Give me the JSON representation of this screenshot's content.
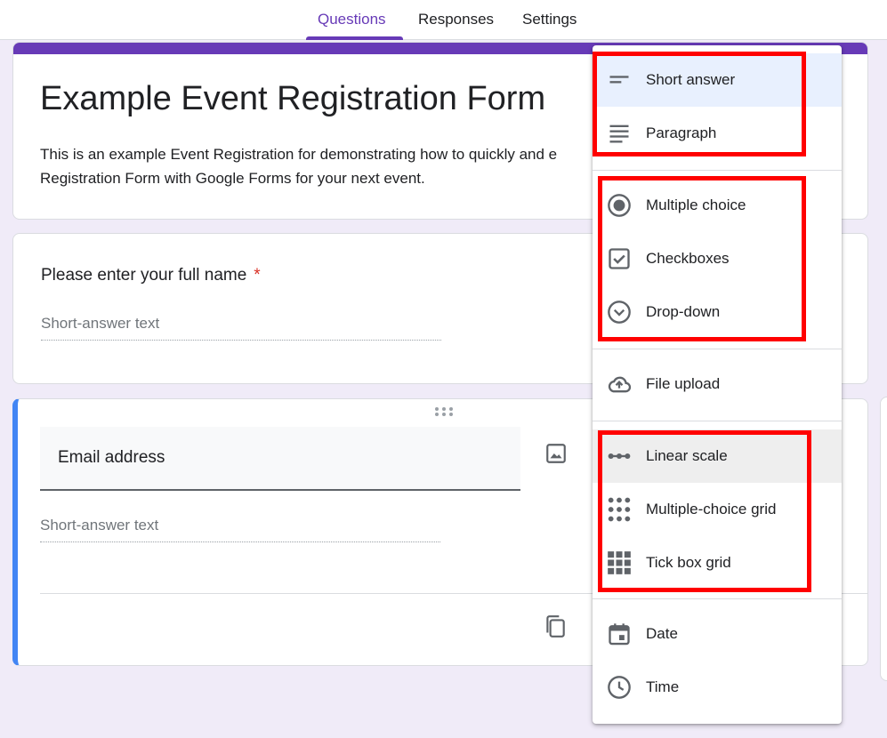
{
  "tabs": [
    {
      "label": "Questions",
      "active": true
    },
    {
      "label": "Responses",
      "active": false
    },
    {
      "label": "Settings",
      "active": false
    }
  ],
  "form": {
    "title": "Example Event Registration Form",
    "description": "This is an example Event Registration for demonstrating how to quickly and e Registration Form with Google Forms for your next event."
  },
  "questions": [
    {
      "title": "Please enter your full name",
      "required_mark": "*",
      "placeholder": "Short-answer text"
    },
    {
      "title": "Email address",
      "placeholder": "Short-answer text"
    }
  ],
  "type_menu": {
    "items": [
      {
        "label": "Short answer",
        "icon": "short-answer-icon",
        "state": "selected"
      },
      {
        "label": "Paragraph",
        "icon": "paragraph-icon"
      },
      {
        "label": "Multiple choice",
        "icon": "radio-icon"
      },
      {
        "label": "Checkboxes",
        "icon": "checkbox-icon"
      },
      {
        "label": "Drop-down",
        "icon": "dropdown-icon"
      },
      {
        "label": "File upload",
        "icon": "cloud-upload-icon"
      },
      {
        "label": "Linear scale",
        "icon": "linear-scale-icon",
        "state": "hover"
      },
      {
        "label": "Multiple-choice grid",
        "icon": "dot-grid-icon"
      },
      {
        "label": "Tick box grid",
        "icon": "square-grid-icon"
      },
      {
        "label": "Date",
        "icon": "calendar-icon"
      },
      {
        "label": "Time",
        "icon": "clock-icon"
      }
    ]
  },
  "colors": {
    "accent": "#673ab7",
    "active_question_border": "#4285f4",
    "highlight_box": "#ff0000",
    "background": "#f0ebf8",
    "required": "#d93025"
  }
}
